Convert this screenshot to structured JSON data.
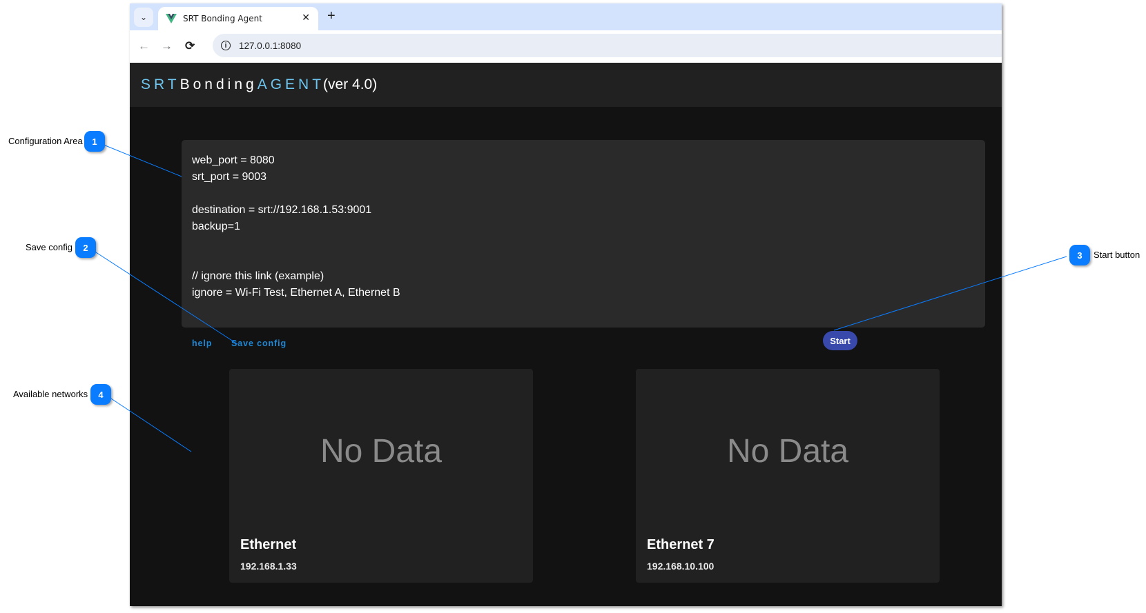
{
  "browser": {
    "tab": {
      "title": "SRT Bonding Agent",
      "favicon": "vue-logo-icon",
      "close_glyph": "✕"
    },
    "tab_list_glyph": "⌄",
    "new_tab_glyph": "+",
    "nav": {
      "back_glyph": "←",
      "forward_glyph": "→",
      "reload_glyph": "⟳"
    },
    "address": {
      "url": "127.0.0.1:8080",
      "info_glyph": "i"
    }
  },
  "app": {
    "brand": {
      "part1": "SRT",
      "part2": "Bonding",
      "part3": "AGENT",
      "version": "(ver 4.0)"
    },
    "config_text": "web_port = 8080\nsrt_port = 9003\n\ndestination = srt://192.168.1.53:9001\nbackup=1\n\n\n// ignore this link (example)\nignore = Wi-Fi Test, Ethernet A, Ethernet B",
    "actions": {
      "help": "help",
      "save_config": "Save config",
      "start": "Start"
    },
    "networks": [
      {
        "placeholder": "No Data",
        "name": "Ethernet",
        "ip": "192.168.1.33"
      },
      {
        "placeholder": "No Data",
        "name": "Ethernet 7",
        "ip": "192.168.10.100"
      }
    ],
    "colors": {
      "accent": "#6ec6f0",
      "link": "#1e88d6",
      "start_button": "#3949ab",
      "background": "#121212",
      "card": "#212121"
    }
  },
  "annotations": [
    {
      "number": "1",
      "label": "Configuration Area"
    },
    {
      "number": "2",
      "label": "Save config"
    },
    {
      "number": "3",
      "label": "Start button"
    },
    {
      "number": "4",
      "label": "Available networks"
    }
  ]
}
